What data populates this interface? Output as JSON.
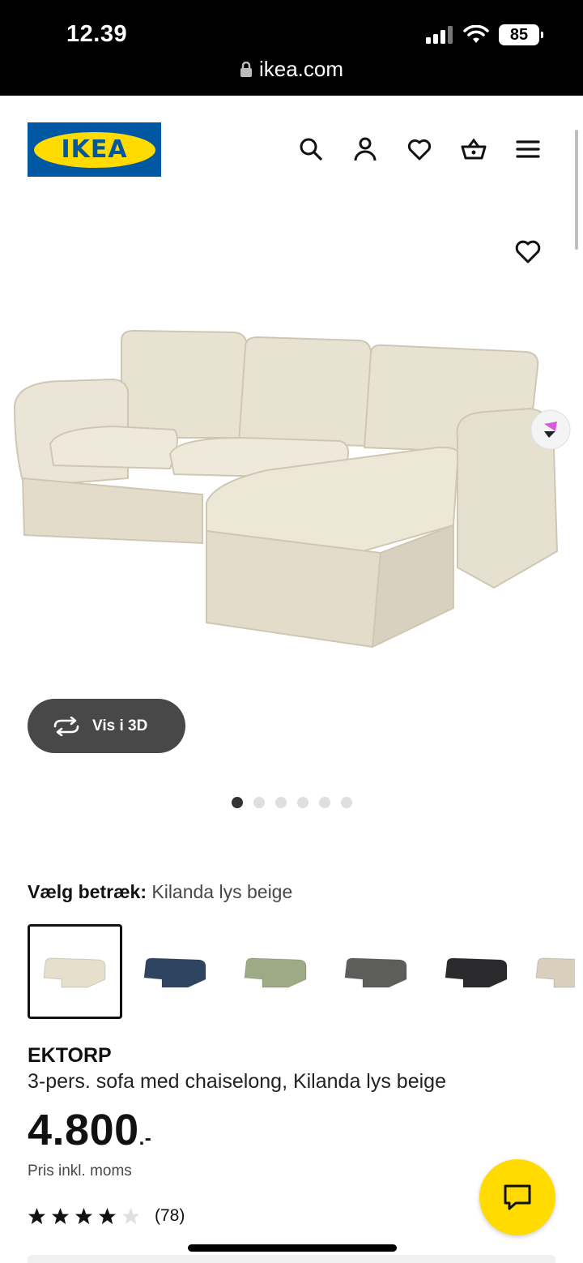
{
  "status_bar": {
    "time": "12.39",
    "battery": "85",
    "url": "ikea.com"
  },
  "header": {
    "logo_text": "IKEA",
    "icons": [
      "search-icon",
      "account-icon",
      "heart-icon",
      "basket-icon",
      "menu-icon"
    ]
  },
  "gallery": {
    "view_3d_label": "Vis i 3D",
    "image_count": 6,
    "active_image": 1
  },
  "variant": {
    "label": "Vælg betræk:",
    "selected_value": "Kilanda lys beige",
    "swatches": [
      {
        "color": "#e6dfcb",
        "selected": true
      },
      {
        "color": "#2f4461",
        "selected": false
      },
      {
        "color": "#9caa86",
        "selected": false
      },
      {
        "color": "#5d5d5b",
        "selected": false
      },
      {
        "color": "#2a2a2c",
        "selected": false
      },
      {
        "color": "#d9cfbd",
        "selected": false
      }
    ]
  },
  "product": {
    "name": "EKTORP",
    "description": "3-pers. sofa med chaiselong, Kilanda lys beige",
    "price": "4.800",
    "price_suffix": ".-",
    "vat_note": "Pris inkl. moms",
    "rating": 4,
    "rating_max": 5,
    "review_count": "(78)"
  },
  "colors": {
    "ikea_blue": "#0058a3",
    "ikea_yellow": "#ffdb00",
    "dark_pill": "#484848"
  }
}
